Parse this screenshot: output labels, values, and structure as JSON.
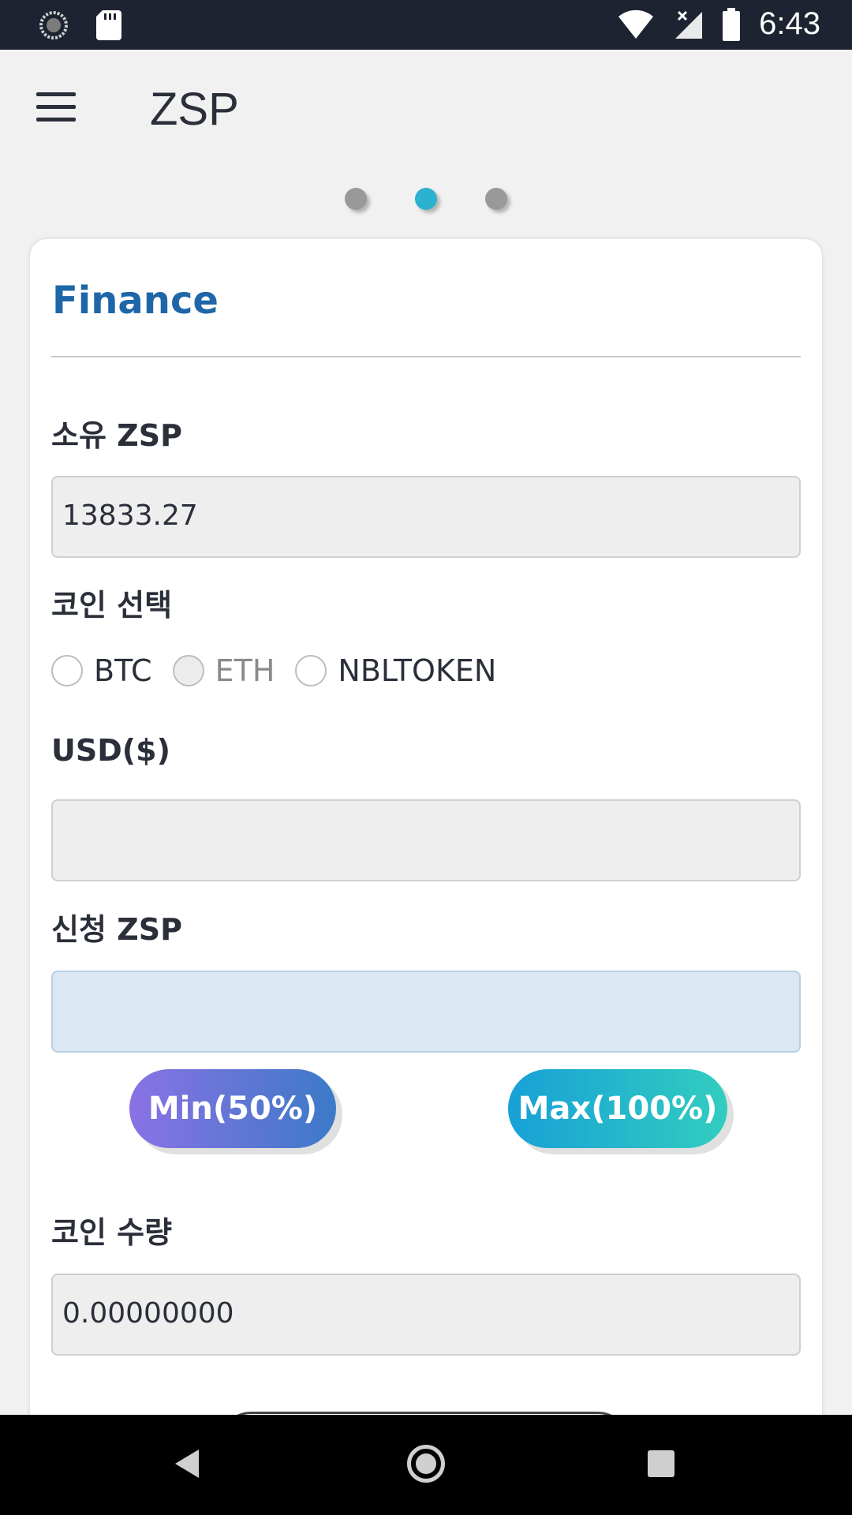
{
  "status_bar": {
    "time": "6:43",
    "icons": [
      "sync-icon",
      "sd-card-icon",
      "wifi-icon",
      "signal-icon",
      "battery-icon"
    ]
  },
  "app_bar": {
    "title": "ZSP",
    "menu_icon": "menu-icon"
  },
  "pager": {
    "count": 3,
    "active_index": 1,
    "active_color": "#2ab2cf",
    "inactive_color": "#999999"
  },
  "card": {
    "title": "Finance",
    "title_color": "#1e66a8",
    "owned_zsp_label": "소유 ZSP",
    "owned_zsp_value": "13833.27",
    "coin_select_label": "코인 선택",
    "coin_options": [
      {
        "label": "BTC",
        "selected": false,
        "disabled": false
      },
      {
        "label": "ETH",
        "selected": false,
        "disabled": true
      },
      {
        "label": "NBLTOKEN",
        "selected": false,
        "disabled": false
      }
    ],
    "usd_label": "USD($)",
    "usd_value": "",
    "apply_zsp_label": "신청 ZSP",
    "apply_zsp_value": "",
    "min_button": "Min(50%)",
    "max_button": "Max(100%)",
    "coin_amount_label": "코인 수량",
    "coin_amount_value": "0.00000000"
  },
  "nav_bar": {
    "icons": [
      "back-icon",
      "home-icon",
      "recent-apps-icon"
    ]
  }
}
